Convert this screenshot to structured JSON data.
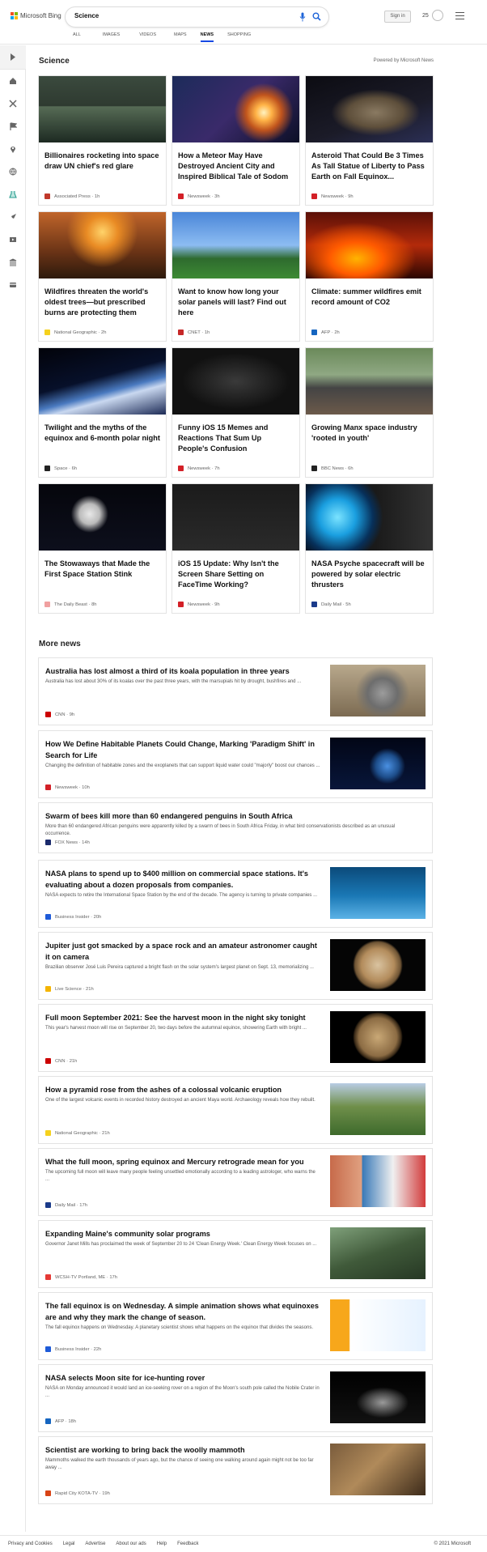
{
  "header": {
    "logo_text": "Microsoft Bing",
    "search_value": "Science",
    "signin_label": "Sign in",
    "rewards_count": "25",
    "tabs": [
      {
        "label": "ALL"
      },
      {
        "label": "IMAGES"
      },
      {
        "label": "VIDEOS"
      },
      {
        "label": "MAPS"
      },
      {
        "label": "NEWS"
      },
      {
        "label": "SHOPPING"
      }
    ],
    "active_tab": "NEWS"
  },
  "sidebar": {
    "icons": [
      "expand-icon",
      "home-icon",
      "tools-icon",
      "flag-icon",
      "location-icon",
      "globe-icon",
      "science-icon",
      "rocket-icon",
      "video-icon",
      "bank-icon",
      "card-icon"
    ]
  },
  "main": {
    "section_title": "Science",
    "powered_by": "Powered by Microsoft News",
    "cards": [
      {
        "title": "Billionaires rocketing into space draw UN chief's red glare",
        "source": "Associated Press",
        "time": "1h",
        "logo_color": "#c0392b",
        "image": "speaker"
      },
      {
        "title": "How a Meteor May Have Destroyed Ancient City and Inspired Biblical Tale of Sodom",
        "source": "Newsweek",
        "time": "3h",
        "logo_color": "#d32027",
        "image": "meteor"
      },
      {
        "title": "Asteroid That Could Be 3 Times As Tall Statue of Liberty to Pass Earth on Fall Equinox...",
        "source": "Newsweek",
        "time": "9h",
        "logo_color": "#d32027",
        "image": "asteroid"
      },
      {
        "title": "Wildfires threaten the world's oldest trees—but prescribed burns are protecting them",
        "source": "National Geographic",
        "time": "2h",
        "logo_color": "#f5d11d",
        "image": "trees"
      },
      {
        "title": "Want to know how long your solar panels will last? Find out here",
        "source": "CNET",
        "time": "1h",
        "logo_color": "#c62828",
        "image": "solar"
      },
      {
        "title": "Climate: summer wildfires emit record amount of CO2",
        "source": "AFP",
        "time": "2h",
        "logo_color": "#1565c0",
        "image": "fire"
      },
      {
        "title": "Twilight and the myths of the equinox and 6-month polar night",
        "source": "Space",
        "time": "6h",
        "logo_color": "#222222",
        "image": "earth"
      },
      {
        "title": "Funny iOS 15 Memes and Reactions That Sum Up People's Confusion",
        "source": "Newsweek",
        "time": "7h",
        "logo_color": "#d32027",
        "image": "iphone"
      },
      {
        "title": "Growing Manx space industry 'rooted in youth'",
        "source": "BBC News",
        "time": "6h",
        "logo_color": "#222222",
        "image": "students"
      },
      {
        "title": "The Stowaways that Made the First Space Station Stink",
        "source": "The Daily Beast",
        "time": "8h",
        "logo_color": "#f0a0a0",
        "image": "astronaut"
      },
      {
        "title": "iOS 15 Update: Why Isn't the Screen Share Setting on FaceTime Working?",
        "source": "Newsweek",
        "time": "9h",
        "logo_color": "#d32027",
        "image": "apps"
      },
      {
        "title": "NASA Psyche spacecraft will be powered by solar electric thrusters",
        "source": "Daily Mail",
        "time": "5h",
        "logo_color": "#1a3a8a",
        "image": "thruster"
      }
    ],
    "more_news_title": "More news",
    "news": [
      {
        "title": "Australia has lost almost a third of its koala population in three years",
        "desc": "Australia has lost about 30% of its koalas over the past three years, with the marsupials hit by drought, bushfires and ...",
        "source": "CNN",
        "time": "9h",
        "logo_color": "#cc0000",
        "image": "koala"
      },
      {
        "title": "How We Define Habitable Planets Could Change, Marking 'Paradigm Shift' in Search for Life",
        "desc": "Changing the definition of habitable zones and the exoplanets that can support liquid water could \"majorly\" boost our chances ...",
        "source": "Newsweek",
        "time": "10h",
        "logo_color": "#d32027",
        "image": "planets"
      },
      {
        "title": "Swarm of bees kill more than 60 endangered penguins in South Africa",
        "desc": "More than 60 endangered African penguins were apparently killed by a swarm of bees in South Africa Friday, in what bird conservationists described as an unusual occurrence.",
        "source": "FOX News",
        "time": "14h",
        "logo_color": "#1a2a6c",
        "image": ""
      },
      {
        "title": "NASA plans to spend up to $400 million on commercial space stations. It's evaluating about a dozen proposals from companies.",
        "desc": "NASA expects to retire the International Space Station by the end of the decade. The agency is turning to private companies ...",
        "source": "Business Insider",
        "time": "20h",
        "logo_color": "#1e5bd8",
        "image": "station"
      },
      {
        "title": "Jupiter just got smacked by a space rock and an amateur astronomer caught it on camera",
        "desc": "Brazilian observer José Luis Pereira captured a bright flash on the solar system's largest planet on Sept. 13, memorializing ...",
        "source": "Live Science",
        "time": "21h",
        "logo_color": "#f4b400",
        "image": "jupiter"
      },
      {
        "title": "Full moon September 2021: See the harvest moon in the night sky tonight",
        "desc": "This year's harvest moon will rise on September 20, two days before the autumnal equinox, showering Earth with bright ...",
        "source": "CNN",
        "time": "21h",
        "logo_color": "#cc0000",
        "image": "moon"
      },
      {
        "title": "How a pyramid rose from the ashes of a colossal volcanic eruption",
        "desc": "One of the largest volcanic events in recorded history destroyed an ancient Maya world. Archaeology reveals how they rebuilt.",
        "source": "National Geographic",
        "time": "21h",
        "logo_color": "#f5d11d",
        "image": "volcano"
      },
      {
        "title": "What the full moon, spring equinox and Mercury retrograde mean for you",
        "desc": "The upcoming full moon will leave many people feeling unsettled emotionally according to a leading astrologer, who warns the ...",
        "source": "Daily Mail",
        "time": "17h",
        "logo_color": "#1a3a8a",
        "image": "collage"
      },
      {
        "title": "Expanding Maine's community solar programs",
        "desc": "Governor Janet Mills has proclaimed the week of September 20 to 24 'Clean Energy Week.' Clean Energy Week focuses on ...",
        "source": "WCSH-TV Portland, ME",
        "time": "17h",
        "logo_color": "#e53935",
        "image": "solarfarm"
      },
      {
        "title": "The fall equinox is on Wednesday. A simple animation shows what equinoxes are and why they mark the change of season.",
        "desc": "The fall equinox happens on Wednesday. A planetary scientist shows what happens on the equinox that divides the seasons.",
        "source": "Business Insider",
        "time": "22h",
        "logo_color": "#1e5bd8",
        "image": "equinox"
      },
      {
        "title": "NASA selects Moon site for ice-hunting rover",
        "desc": "NASA on Monday announced it would land an ice-seeking rover on a region of the Moon's south pole called the Nobile Crater in ...",
        "source": "AFP",
        "time": "18h",
        "logo_color": "#1565c0",
        "image": "rover"
      },
      {
        "title": "Scientist are working to bring back the woolly mammoth",
        "desc": "Mammoths walked the earth thousands of years ago, but the chance of seeing one walking around again might not be too far away ...",
        "source": "Rapid City KOTA-TV",
        "time": "19h",
        "logo_color": "#d84315",
        "image": "museum"
      }
    ]
  },
  "footer": {
    "links": [
      "Privacy and Cookies",
      "Legal",
      "Advertise",
      "About our ads",
      "Help",
      "Feedback"
    ],
    "copyright": "© 2021 Microsoft"
  }
}
